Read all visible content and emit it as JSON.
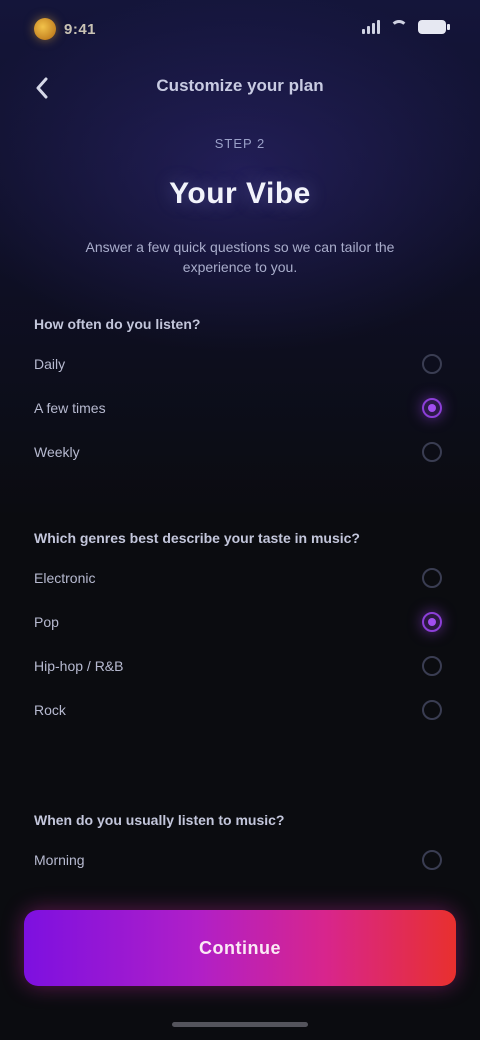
{
  "status_bar": {
    "time": "9:41",
    "battery_icon": "battery-icon",
    "wifi_icon": "wifi-icon",
    "signal_icon": "signal-icon"
  },
  "nav": {
    "back_icon": "chevron-left-icon",
    "title": "Customize your plan"
  },
  "hero": {
    "kicker": "STEP 2",
    "title": "Your Vibe",
    "description": "Answer a few quick questions so we can tailor the experience to you."
  },
  "sections": [
    {
      "title": "How often do you listen?",
      "options": [
        {
          "label": "Daily",
          "selected": false
        },
        {
          "label": "A few times",
          "selected": true
        },
        {
          "label": "Weekly",
          "selected": false
        }
      ]
    },
    {
      "title": "Which genres best describe your taste in music?",
      "options": [
        {
          "label": "Electronic",
          "selected": false
        },
        {
          "label": "Pop",
          "selected": true
        },
        {
          "label": "Hip-hop / R&B",
          "selected": false
        },
        {
          "label": "Rock",
          "selected": false
        }
      ]
    },
    {
      "title": "When do you usually listen to music?",
      "options": [
        {
          "label": "Morning",
          "selected": false
        }
      ]
    }
  ],
  "cta": {
    "label": "Continue"
  },
  "colors": {
    "accent": "#8c3fd8",
    "cta_start": "#7d10e0",
    "cta_end": "#e8302e",
    "background": "#0b0c10"
  }
}
